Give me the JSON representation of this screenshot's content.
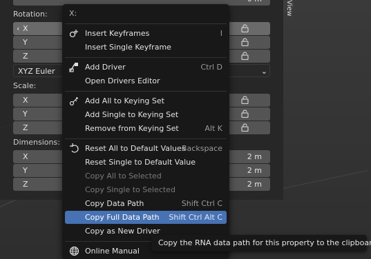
{
  "panel": {
    "rotation_label": "Rotation:",
    "rotation": [
      {
        "axis": "X",
        "value": ""
      },
      {
        "axis": "Y",
        "value": ""
      },
      {
        "axis": "Z",
        "value": ""
      }
    ],
    "rotation_mode": "XYZ Euler",
    "scale_label": "Scale:",
    "scale": [
      {
        "axis": "X",
        "value": ""
      },
      {
        "axis": "Y",
        "value": ""
      },
      {
        "axis": "Z",
        "value": ""
      }
    ],
    "dimensions_label": "Dimensions:",
    "dimensions": [
      {
        "axis": "X",
        "value": "2 m"
      },
      {
        "axis": "Y",
        "value": "2 m"
      },
      {
        "axis": "Z",
        "value": "2 m"
      }
    ],
    "top_value": "0 m",
    "side_tab": "View"
  },
  "menu": {
    "title": "X:",
    "items": [
      {
        "label": "Insert Keyframes",
        "shortcut": "I",
        "icon": "keyframe-icon"
      },
      {
        "label": "Insert Single Keyframe",
        "shortcut": ""
      },
      {
        "label": "Add Driver",
        "shortcut": "Ctrl D",
        "icon": "driver-icon"
      },
      {
        "label": "Open Drivers Editor",
        "shortcut": ""
      },
      {
        "label": "Add All to Keying Set",
        "shortcut": "",
        "icon": "keying-set-icon"
      },
      {
        "label": "Add Single to Keying Set",
        "shortcut": ""
      },
      {
        "label": "Remove from Keying Set",
        "shortcut": "Alt K"
      },
      {
        "label": "Reset All to Default Values",
        "shortcut": "Backspace",
        "icon": "reset-icon"
      },
      {
        "label": "Reset Single to Default Value",
        "shortcut": ""
      },
      {
        "label": "Copy All to Selected",
        "shortcut": "",
        "disabled": true
      },
      {
        "label": "Copy Single to Selected",
        "shortcut": "",
        "disabled": true
      },
      {
        "label": "Copy Data Path",
        "shortcut": "Shift Ctrl C"
      },
      {
        "label": "Copy Full Data Path",
        "shortcut": "Shift Ctrl Alt C",
        "highlighted": true
      },
      {
        "label": "Copy as New Driver",
        "shortcut": ""
      },
      {
        "label": "Online Manual",
        "shortcut": "",
        "icon": "globe-icon"
      }
    ]
  },
  "tooltip": "Copy the RNA data path for this property to the clipboard.",
  "colors": {
    "menu_bg": "#181818",
    "highlight": "#4772b3",
    "field": "#545454"
  }
}
